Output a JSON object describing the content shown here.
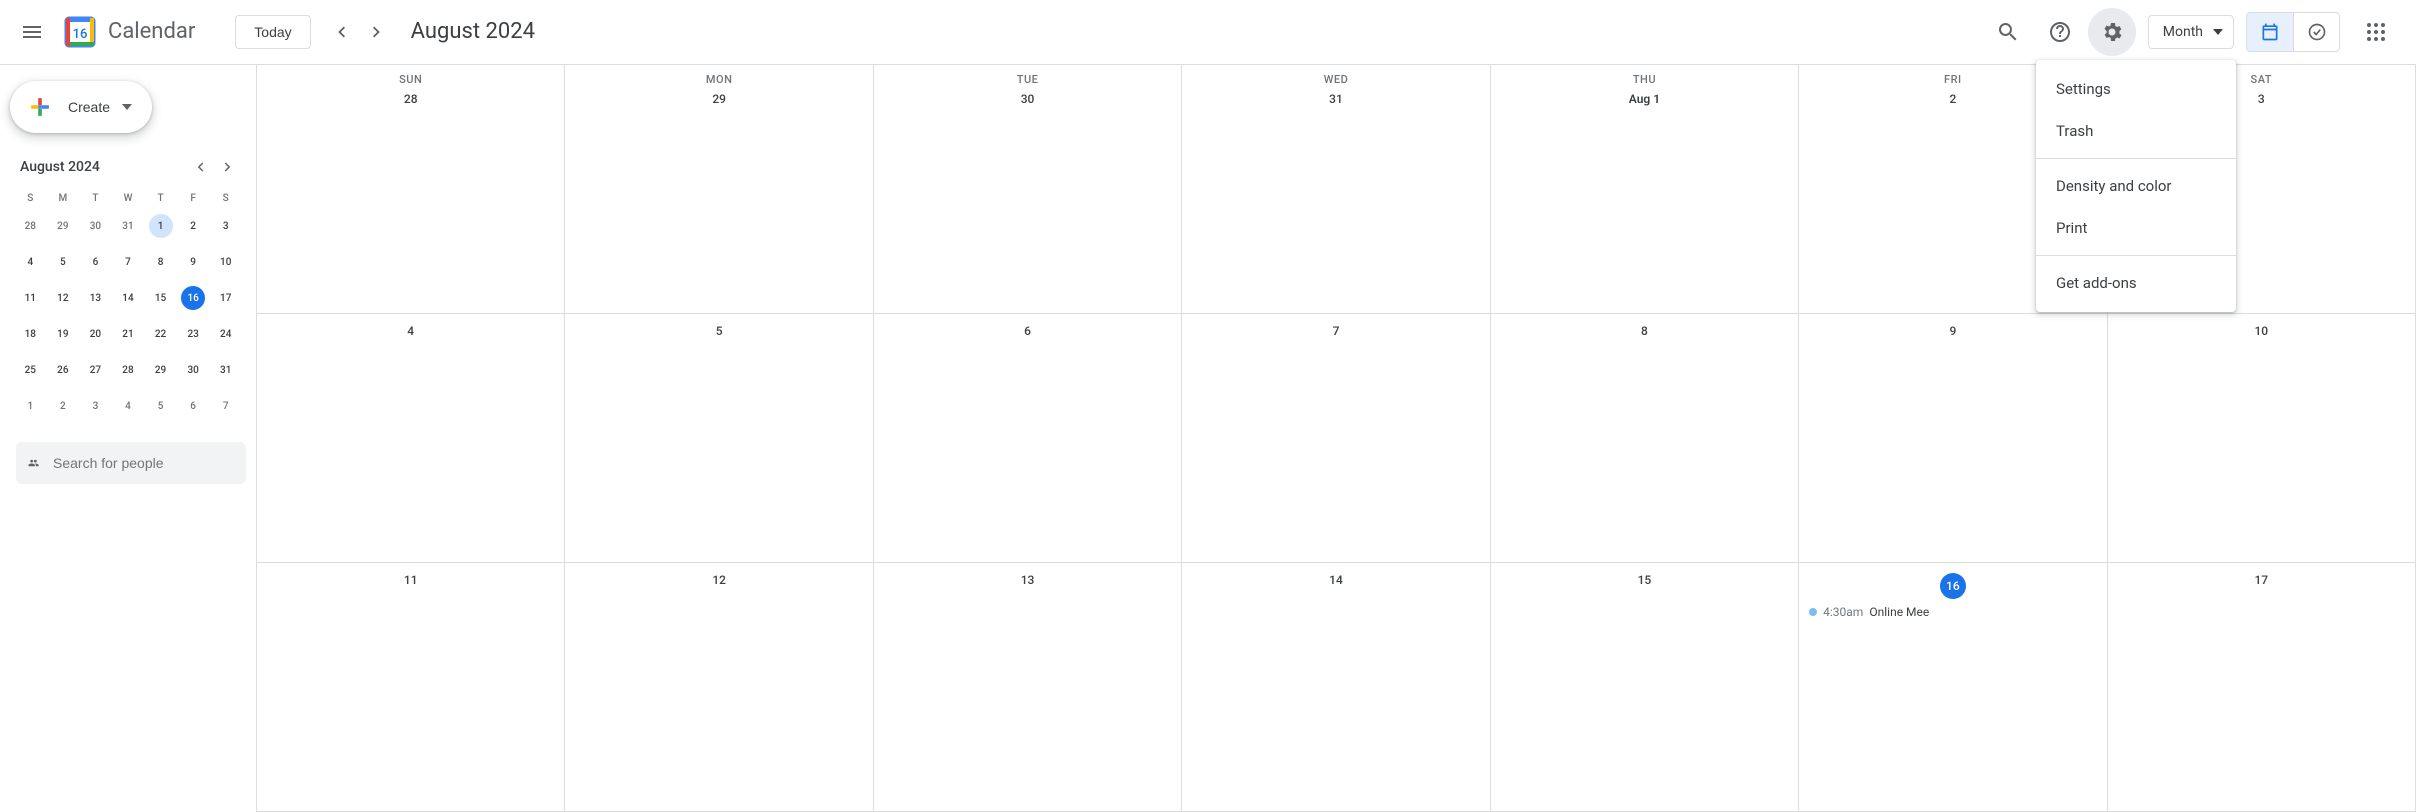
{
  "header": {
    "app_title": "Calendar",
    "logo_day": "16",
    "today_label": "Today",
    "month_title": "August 2024",
    "view_label": "Month"
  },
  "settings_menu": {
    "items": [
      "Settings",
      "Trash",
      "Density and color",
      "Print",
      "Get add-ons"
    ],
    "separators_after": [
      1,
      3
    ]
  },
  "sidebar": {
    "create_label": "Create",
    "minical": {
      "title": "August 2024",
      "day_headers": [
        "S",
        "M",
        "T",
        "W",
        "T",
        "F",
        "S"
      ],
      "weeks": [
        [
          {
            "d": "28",
            "o": true
          },
          {
            "d": "29",
            "o": true
          },
          {
            "d": "30",
            "o": true
          },
          {
            "d": "31",
            "o": true
          },
          {
            "d": "1",
            "ring": true
          },
          {
            "d": "2"
          },
          {
            "d": "3"
          }
        ],
        [
          {
            "d": "4"
          },
          {
            "d": "5"
          },
          {
            "d": "6"
          },
          {
            "d": "7"
          },
          {
            "d": "8"
          },
          {
            "d": "9"
          },
          {
            "d": "10"
          }
        ],
        [
          {
            "d": "11"
          },
          {
            "d": "12"
          },
          {
            "d": "13"
          },
          {
            "d": "14"
          },
          {
            "d": "15"
          },
          {
            "d": "16",
            "today": true
          },
          {
            "d": "17"
          }
        ],
        [
          {
            "d": "18"
          },
          {
            "d": "19"
          },
          {
            "d": "20"
          },
          {
            "d": "21"
          },
          {
            "d": "22"
          },
          {
            "d": "23"
          },
          {
            "d": "24"
          }
        ],
        [
          {
            "d": "25"
          },
          {
            "d": "26"
          },
          {
            "d": "27"
          },
          {
            "d": "28"
          },
          {
            "d": "29"
          },
          {
            "d": "30"
          },
          {
            "d": "31"
          }
        ],
        [
          {
            "d": "1",
            "o": true
          },
          {
            "d": "2",
            "o": true
          },
          {
            "d": "3",
            "o": true
          },
          {
            "d": "4",
            "o": true
          },
          {
            "d": "5",
            "o": true
          },
          {
            "d": "6",
            "o": true
          },
          {
            "d": "7",
            "o": true
          }
        ]
      ]
    },
    "search_placeholder": "Search for people"
  },
  "grid": {
    "day_headers": [
      "SUN",
      "MON",
      "TUE",
      "WED",
      "THU",
      "FRI",
      "SAT"
    ],
    "rows": [
      [
        {
          "label": "28"
        },
        {
          "label": "29"
        },
        {
          "label": "30"
        },
        {
          "label": "31"
        },
        {
          "label": "Aug 1",
          "bold": true
        },
        {
          "label": "2"
        },
        {
          "label": "3"
        }
      ],
      [
        {
          "label": "4"
        },
        {
          "label": "5"
        },
        {
          "label": "6"
        },
        {
          "label": "7"
        },
        {
          "label": "8"
        },
        {
          "label": "9"
        },
        {
          "label": "10"
        }
      ],
      [
        {
          "label": "11"
        },
        {
          "label": "12"
        },
        {
          "label": "13"
        },
        {
          "label": "14"
        },
        {
          "label": "15"
        },
        {
          "label": "16",
          "today": true,
          "events": [
            {
              "time": "4:30am",
              "title": "Online Mee"
            }
          ]
        },
        {
          "label": "17"
        }
      ]
    ]
  }
}
